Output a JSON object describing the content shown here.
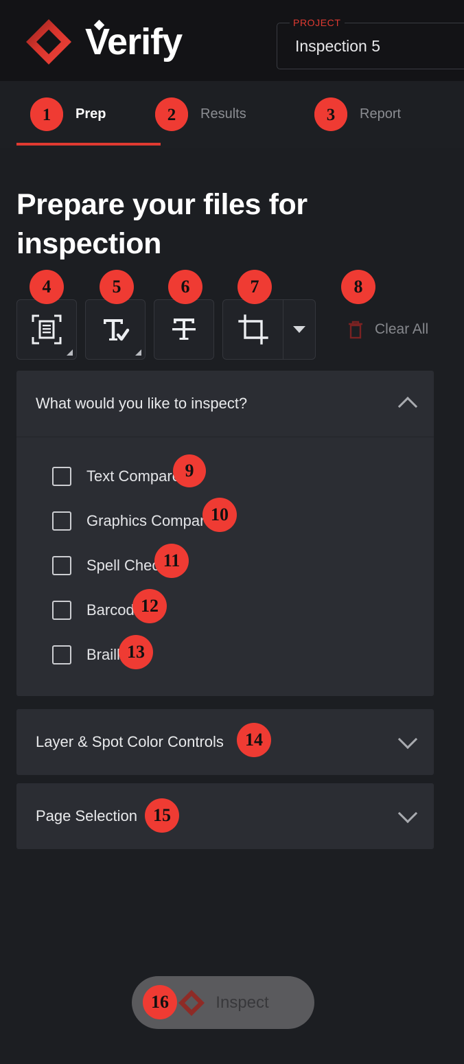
{
  "app": {
    "brand_name": "Verify",
    "brand_icon": "diamond-logo-icon",
    "accent_color": "#e03a31",
    "badge_color": "#ef3b33",
    "page_bg": "#1c1e22",
    "panel_bg": "#2b2d33",
    "header_bg": "#131316"
  },
  "header": {
    "project_label": "PROJECT",
    "project_value": "Inspection 5"
  },
  "tabs": [
    {
      "number": "1",
      "label": "Prep",
      "active": true
    },
    {
      "number": "2",
      "label": "Results",
      "active": false
    },
    {
      "number": "3",
      "label": "Report",
      "active": false
    }
  ],
  "main": {
    "page_title": "Prepare your files for inspection"
  },
  "toolbar": {
    "buttons": [
      {
        "badge": "4",
        "icon": "document-scan-select-icon",
        "has_corner_marker": true
      },
      {
        "badge": "5",
        "icon": "text-check-icon",
        "has_corner_marker": true
      },
      {
        "badge": "6",
        "icon": "text-baseline-icon",
        "has_corner_marker": false
      },
      {
        "badge": "7",
        "icon": "crop-icon",
        "has_dropdown": true
      }
    ],
    "clear_all": {
      "badge": "8",
      "label": "Clear All",
      "icon": "trash-icon",
      "disabled": true,
      "icon_color": "#7a2222",
      "label_color": "#86888d"
    }
  },
  "panels": [
    {
      "title": "What would you like to inspect?",
      "expanded": true,
      "chevron": "chevron-up-icon",
      "items": [
        {
          "badge": "9",
          "label": "Text Compare",
          "checked": false
        },
        {
          "badge": "10",
          "label": "Graphics Compare",
          "checked": false
        },
        {
          "badge": "11",
          "label": "Spell Check",
          "checked": false
        },
        {
          "badge": "12",
          "label": "Barcode",
          "checked": false
        },
        {
          "badge": "13",
          "label": "Braille",
          "checked": false
        }
      ]
    },
    {
      "title": "Layer & Spot Color Controls",
      "badge": "14",
      "expanded": false,
      "chevron": "chevron-down-icon",
      "items": []
    },
    {
      "title": "Page Selection",
      "badge": "15",
      "expanded": false,
      "chevron": "chevron-down-icon",
      "items": []
    }
  ],
  "footer": {
    "inspect_button": {
      "badge": "16",
      "label": "Inspect",
      "icon": "diamond-logo-icon",
      "disabled": true
    }
  }
}
